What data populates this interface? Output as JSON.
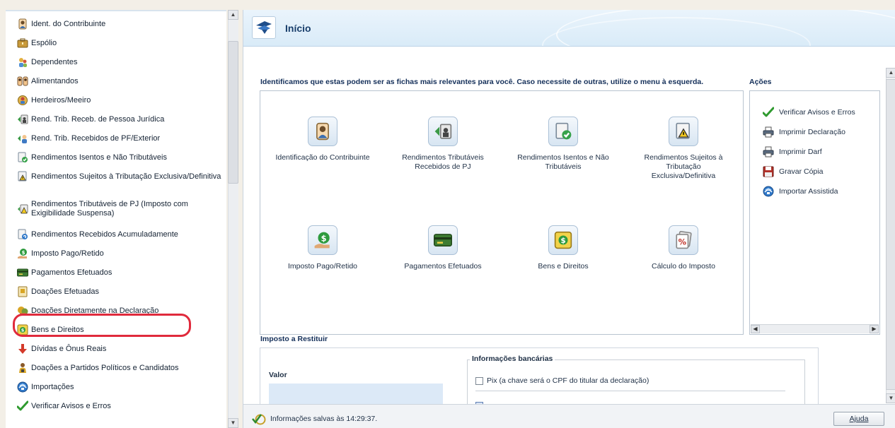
{
  "sidebar": {
    "items": [
      {
        "label": "Ident. do Contribuinte",
        "icon": "person-icon"
      },
      {
        "label": "Espólio",
        "icon": "briefcase-icon"
      },
      {
        "label": "Dependentes",
        "icon": "dependents-icon"
      },
      {
        "label": "Alimentandos",
        "icon": "people-icon"
      },
      {
        "label": "Herdeiros/Meeiro",
        "icon": "heirs-icon"
      },
      {
        "label": "Rend. Trib. Receb. de Pessoa Jurídica",
        "icon": "income-pj-icon"
      },
      {
        "label": "Rend. Trib. Recebidos de PF/Exterior",
        "icon": "income-pf-icon"
      },
      {
        "label": "Rendimentos Isentos e Não Tributáveis",
        "icon": "exempt-income-icon"
      },
      {
        "label": "Rendimentos Sujeitos à Tributação Exclusiva/Definitiva",
        "icon": "exclusive-income-icon"
      },
      {
        "label": "Rendimentos Tributáveis de PJ (Imposto com Exigibilidade Suspensa)",
        "icon": "suspended-income-icon"
      },
      {
        "label": "Rendimentos Recebidos Acumuladamente",
        "icon": "accumulated-income-icon"
      },
      {
        "label": "Imposto Pago/Retido",
        "icon": "tax-paid-icon"
      },
      {
        "label": "Pagamentos Efetuados",
        "icon": "payment-card-icon"
      },
      {
        "label": "Doações Efetuadas",
        "icon": "donation-icon"
      },
      {
        "label": "Doações Diretamente na Declaração",
        "icon": "direct-donation-icon"
      },
      {
        "label": "Bens e Direitos",
        "icon": "assets-icon"
      },
      {
        "label": "Dívidas e Ônus Reais",
        "icon": "debts-icon"
      },
      {
        "label": "Doações a Partidos Políticos e Candidatos",
        "icon": "political-donation-icon"
      },
      {
        "label": "Importações",
        "icon": "import-icon"
      },
      {
        "label": "Verificar Avisos e Erros",
        "icon": "checkmark-icon"
      }
    ]
  },
  "header": {
    "title": "Início"
  },
  "main": {
    "intro": "Identificamos que estas podem ser as fichas mais relevantes para você. Caso necessite de outras, utilize o menu à esquerda.",
    "cards": [
      {
        "label": "Identificação do Contribuinte",
        "icon": "person-icon"
      },
      {
        "label": "Rendimentos Tributáveis Recebidos de PJ",
        "icon": "income-pj-icon"
      },
      {
        "label": "Rendimentos Isentos e Não Tributáveis",
        "icon": "exempt-income-icon"
      },
      {
        "label": "Rendimentos Sujeitos à Tributação Exclusiva/Definitiva",
        "icon": "exclusive-income-icon"
      },
      {
        "label": "Imposto Pago/Retido",
        "icon": "tax-paid-icon"
      },
      {
        "label": "Pagamentos Efetuados",
        "icon": "payment-card-icon"
      },
      {
        "label": "Bens e Direitos",
        "icon": "assets-icon"
      },
      {
        "label": "Cálculo do Imposto",
        "icon": "tax-calc-icon"
      }
    ]
  },
  "actions": {
    "title": "Ações",
    "items": [
      {
        "label": "Verificar Avisos e Erros",
        "icon": "checkmark-icon"
      },
      {
        "label": "Imprimir Declaração",
        "icon": "printer-icon"
      },
      {
        "label": "Imprimir Darf",
        "icon": "printer-icon"
      },
      {
        "label": "Gravar Cópia",
        "icon": "save-icon"
      },
      {
        "label": "Importar Assistida",
        "icon": "import-icon"
      }
    ]
  },
  "restituir": {
    "title": "Imposto a Restituir",
    "valor_label": "Valor",
    "bank_title": "Informações bancárias",
    "pix_label": "Pix (a chave será o CPF do titular da declaração)"
  },
  "status": {
    "text": "Informações salvas às 14:29:37.",
    "help_label": "Ajuda"
  },
  "colors": {
    "highlight": "#e02a3c",
    "header_bg": "#d9ebf8",
    "title": "#183e6b"
  }
}
